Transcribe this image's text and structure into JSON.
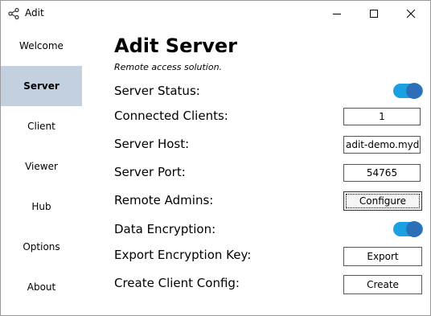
{
  "window": {
    "title": "Adit"
  },
  "sidebar": {
    "items": [
      {
        "label": "Welcome"
      },
      {
        "label": "Server"
      },
      {
        "label": "Client"
      },
      {
        "label": "Viewer"
      },
      {
        "label": "Hub"
      },
      {
        "label": "Options"
      },
      {
        "label": "About"
      }
    ],
    "active": "Server"
  },
  "main": {
    "title": "Adit Server",
    "subtitle": "Remote access solution.",
    "server_status": {
      "label": "Server Status:",
      "on": true
    },
    "connected_clients": {
      "label": "Connected Clients:",
      "value": "1"
    },
    "server_host": {
      "label": "Server Host:",
      "value": "adit-demo.myddn"
    },
    "server_port": {
      "label": "Server Port:",
      "value": "54765"
    },
    "remote_admins": {
      "label": "Remote Admins:",
      "button": "Configure"
    },
    "data_encryption": {
      "label": "Data Encryption:",
      "on": true
    },
    "export_key": {
      "label": "Export Encryption Key:",
      "button": "Export"
    },
    "create_config": {
      "label": "Create Client Config:",
      "button": "Create"
    }
  },
  "colors": {
    "sidebar_active_bg": "#c3d0e0",
    "toggle_track": "#1ba1e2",
    "toggle_knob": "#2d6fb6"
  }
}
